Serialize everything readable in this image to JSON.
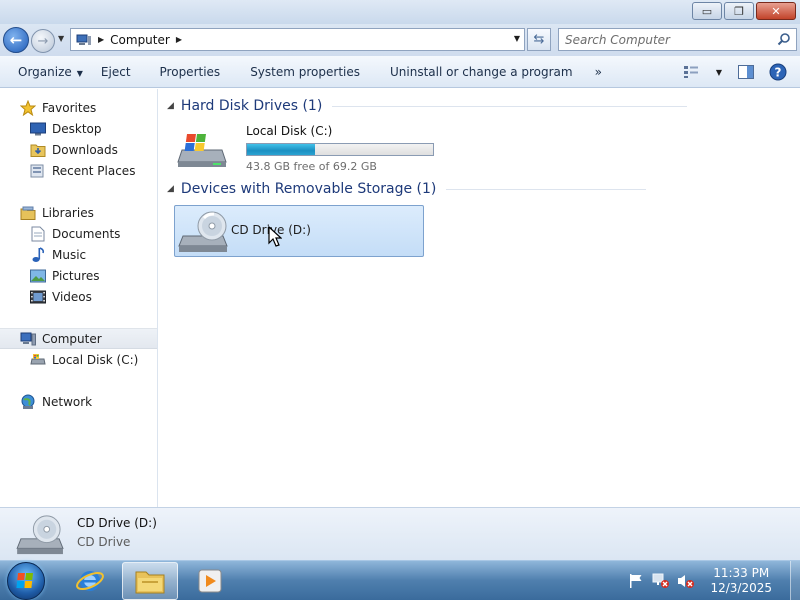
{
  "window": {
    "minimize_glyph": "▭",
    "maximize_glyph": "❐",
    "close_glyph": "✕"
  },
  "address": {
    "crumb": "Computer",
    "search_placeholder": "Search Computer"
  },
  "toolbar": {
    "organize": "Organize",
    "eject": "Eject",
    "properties": "Properties",
    "system_properties": "System properties",
    "uninstall": "Uninstall or change a program",
    "more": "»"
  },
  "nav": {
    "favorites": "Favorites",
    "desktop": "Desktop",
    "downloads": "Downloads",
    "recent_places": "Recent Places",
    "libraries": "Libraries",
    "documents": "Documents",
    "music": "Music",
    "pictures": "Pictures",
    "videos": "Videos",
    "computer": "Computer",
    "local_disk": "Local Disk (C:)",
    "network": "Network"
  },
  "content": {
    "hdd_group": "Hard Disk Drives (1)",
    "removable_group": "Devices with Removable Storage (1)",
    "local_disk_name": "Local Disk (C:)",
    "local_disk_free": "43.8 GB free of 69.2 GB",
    "local_disk_used_fraction": 0.367,
    "cd_name": "CD Drive (D:)"
  },
  "details": {
    "title": "CD Drive (D:)",
    "subtitle": "CD Drive"
  },
  "taskbar": {
    "time": "11:33 PM",
    "date": "12/3/2025"
  },
  "colors": {
    "accent": "#1e3a7a",
    "selection": "#c4ddf7",
    "bar_fill": "#1b8fc2"
  }
}
